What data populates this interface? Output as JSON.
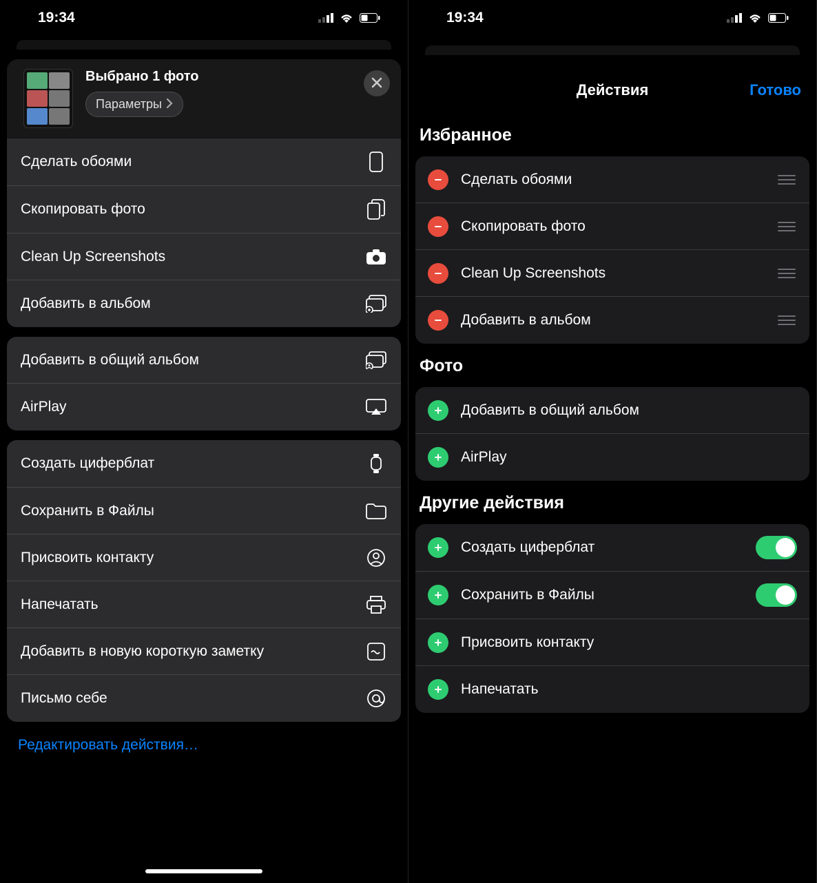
{
  "status": {
    "time": "19:34"
  },
  "left": {
    "title": "Выбрано 1 фото",
    "options_label": "Параметры",
    "groups": [
      [
        {
          "label": "Сделать обоями",
          "icon": "phone"
        },
        {
          "label": "Скопировать фото",
          "icon": "copy"
        },
        {
          "label": "Clean Up Screenshots",
          "icon": "camera"
        },
        {
          "label": "Добавить в альбом",
          "icon": "album"
        }
      ],
      [
        {
          "label": "Добавить в общий альбом",
          "icon": "shared-album"
        },
        {
          "label": "AirPlay",
          "icon": "airplay"
        }
      ],
      [
        {
          "label": "Создать циферблат",
          "icon": "watch"
        },
        {
          "label": "Сохранить в Файлы",
          "icon": "folder"
        },
        {
          "label": "Присвоить контакту",
          "icon": "person"
        },
        {
          "label": "Напечатать",
          "icon": "print"
        },
        {
          "label": "Добавить в новую короткую заметку",
          "icon": "note"
        },
        {
          "label": "Письмо себе",
          "icon": "at"
        }
      ]
    ],
    "edit_link": "Редактировать действия…"
  },
  "right": {
    "title": "Действия",
    "done": "Готово",
    "favorites_title": "Избранное",
    "favorites": [
      {
        "label": "Сделать обоями"
      },
      {
        "label": "Скопировать фото"
      },
      {
        "label": "Clean Up Screenshots"
      },
      {
        "label": "Добавить в альбом"
      }
    ],
    "photo_title": "Фото",
    "photo": [
      {
        "label": "Добавить в общий альбом"
      },
      {
        "label": "AirPlay"
      }
    ],
    "other_title": "Другие действия",
    "other": [
      {
        "label": "Создать циферблат",
        "toggle": true
      },
      {
        "label": "Сохранить в Файлы",
        "toggle": true
      },
      {
        "label": "Присвоить контакту",
        "toggle": false
      },
      {
        "label": "Напечатать",
        "toggle": false
      }
    ]
  }
}
